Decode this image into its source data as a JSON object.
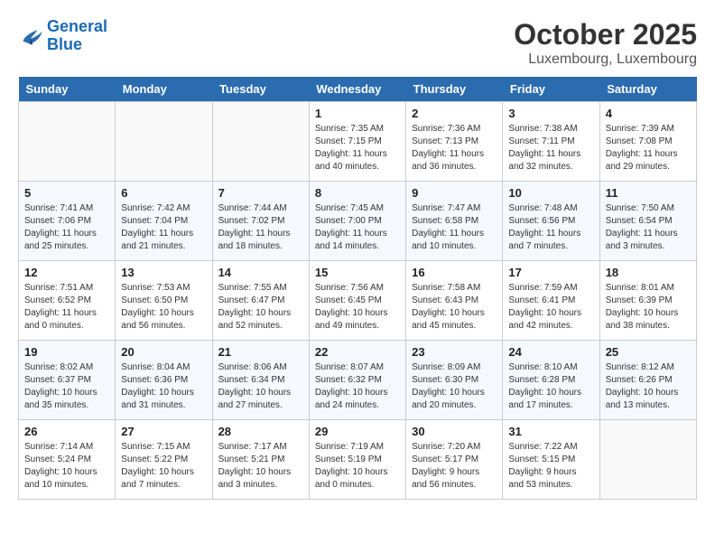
{
  "header": {
    "logo_line1": "General",
    "logo_line2": "Blue",
    "month": "October 2025",
    "location": "Luxembourg, Luxembourg"
  },
  "weekdays": [
    "Sunday",
    "Monday",
    "Tuesday",
    "Wednesday",
    "Thursday",
    "Friday",
    "Saturday"
  ],
  "weeks": [
    [
      {
        "day": "",
        "info": ""
      },
      {
        "day": "",
        "info": ""
      },
      {
        "day": "",
        "info": ""
      },
      {
        "day": "1",
        "info": "Sunrise: 7:35 AM\nSunset: 7:15 PM\nDaylight: 11 hours\nand 40 minutes."
      },
      {
        "day": "2",
        "info": "Sunrise: 7:36 AM\nSunset: 7:13 PM\nDaylight: 11 hours\nand 36 minutes."
      },
      {
        "day": "3",
        "info": "Sunrise: 7:38 AM\nSunset: 7:11 PM\nDaylight: 11 hours\nand 32 minutes."
      },
      {
        "day": "4",
        "info": "Sunrise: 7:39 AM\nSunset: 7:08 PM\nDaylight: 11 hours\nand 29 minutes."
      }
    ],
    [
      {
        "day": "5",
        "info": "Sunrise: 7:41 AM\nSunset: 7:06 PM\nDaylight: 11 hours\nand 25 minutes."
      },
      {
        "day": "6",
        "info": "Sunrise: 7:42 AM\nSunset: 7:04 PM\nDaylight: 11 hours\nand 21 minutes."
      },
      {
        "day": "7",
        "info": "Sunrise: 7:44 AM\nSunset: 7:02 PM\nDaylight: 11 hours\nand 18 minutes."
      },
      {
        "day": "8",
        "info": "Sunrise: 7:45 AM\nSunset: 7:00 PM\nDaylight: 11 hours\nand 14 minutes."
      },
      {
        "day": "9",
        "info": "Sunrise: 7:47 AM\nSunset: 6:58 PM\nDaylight: 11 hours\nand 10 minutes."
      },
      {
        "day": "10",
        "info": "Sunrise: 7:48 AM\nSunset: 6:56 PM\nDaylight: 11 hours\nand 7 minutes."
      },
      {
        "day": "11",
        "info": "Sunrise: 7:50 AM\nSunset: 6:54 PM\nDaylight: 11 hours\nand 3 minutes."
      }
    ],
    [
      {
        "day": "12",
        "info": "Sunrise: 7:51 AM\nSunset: 6:52 PM\nDaylight: 11 hours\nand 0 minutes."
      },
      {
        "day": "13",
        "info": "Sunrise: 7:53 AM\nSunset: 6:50 PM\nDaylight: 10 hours\nand 56 minutes."
      },
      {
        "day": "14",
        "info": "Sunrise: 7:55 AM\nSunset: 6:47 PM\nDaylight: 10 hours\nand 52 minutes."
      },
      {
        "day": "15",
        "info": "Sunrise: 7:56 AM\nSunset: 6:45 PM\nDaylight: 10 hours\nand 49 minutes."
      },
      {
        "day": "16",
        "info": "Sunrise: 7:58 AM\nSunset: 6:43 PM\nDaylight: 10 hours\nand 45 minutes."
      },
      {
        "day": "17",
        "info": "Sunrise: 7:59 AM\nSunset: 6:41 PM\nDaylight: 10 hours\nand 42 minutes."
      },
      {
        "day": "18",
        "info": "Sunrise: 8:01 AM\nSunset: 6:39 PM\nDaylight: 10 hours\nand 38 minutes."
      }
    ],
    [
      {
        "day": "19",
        "info": "Sunrise: 8:02 AM\nSunset: 6:37 PM\nDaylight: 10 hours\nand 35 minutes."
      },
      {
        "day": "20",
        "info": "Sunrise: 8:04 AM\nSunset: 6:36 PM\nDaylight: 10 hours\nand 31 minutes."
      },
      {
        "day": "21",
        "info": "Sunrise: 8:06 AM\nSunset: 6:34 PM\nDaylight: 10 hours\nand 27 minutes."
      },
      {
        "day": "22",
        "info": "Sunrise: 8:07 AM\nSunset: 6:32 PM\nDaylight: 10 hours\nand 24 minutes."
      },
      {
        "day": "23",
        "info": "Sunrise: 8:09 AM\nSunset: 6:30 PM\nDaylight: 10 hours\nand 20 minutes."
      },
      {
        "day": "24",
        "info": "Sunrise: 8:10 AM\nSunset: 6:28 PM\nDaylight: 10 hours\nand 17 minutes."
      },
      {
        "day": "25",
        "info": "Sunrise: 8:12 AM\nSunset: 6:26 PM\nDaylight: 10 hours\nand 13 minutes."
      }
    ],
    [
      {
        "day": "26",
        "info": "Sunrise: 7:14 AM\nSunset: 5:24 PM\nDaylight: 10 hours\nand 10 minutes."
      },
      {
        "day": "27",
        "info": "Sunrise: 7:15 AM\nSunset: 5:22 PM\nDaylight: 10 hours\nand 7 minutes."
      },
      {
        "day": "28",
        "info": "Sunrise: 7:17 AM\nSunset: 5:21 PM\nDaylight: 10 hours\nand 3 minutes."
      },
      {
        "day": "29",
        "info": "Sunrise: 7:19 AM\nSunset: 5:19 PM\nDaylight: 10 hours\nand 0 minutes."
      },
      {
        "day": "30",
        "info": "Sunrise: 7:20 AM\nSunset: 5:17 PM\nDaylight: 9 hours\nand 56 minutes."
      },
      {
        "day": "31",
        "info": "Sunrise: 7:22 AM\nSunset: 5:15 PM\nDaylight: 9 hours\nand 53 minutes."
      },
      {
        "day": "",
        "info": ""
      }
    ]
  ]
}
